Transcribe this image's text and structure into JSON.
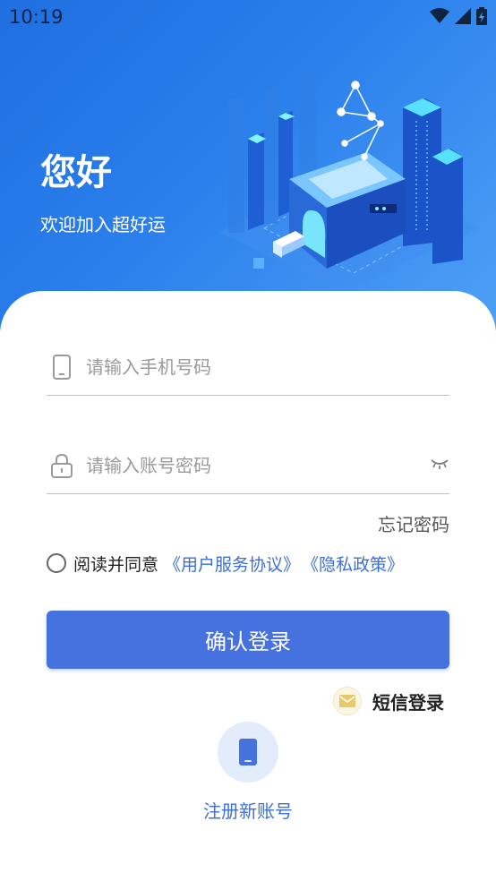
{
  "status_bar": {
    "time": "10:19"
  },
  "hero": {
    "title": "您好",
    "subtitle": "欢迎加入超好运"
  },
  "form": {
    "phone_placeholder": "请输入手机号码",
    "password_placeholder": "请输入账号密码",
    "forgot_label": "忘记密码",
    "agree_text": "阅读并同意",
    "user_agreement": "《用户服务协议》",
    "privacy_policy": "《隐私政策》",
    "login_button": "确认登录",
    "sms_login": "短信登录",
    "register_label": "注册新账号"
  },
  "colors": {
    "accent": "#4672e0",
    "link": "#3d6fd9",
    "hero_start": "#1f6fe0",
    "hero_end": "#4ea0f5"
  },
  "icons": {
    "phone_field": "smartphone-icon",
    "password_field": "lock-icon",
    "toggle_password": "eye-closed-icon",
    "sms": "envelope-icon",
    "register": "mobile-device-icon"
  }
}
